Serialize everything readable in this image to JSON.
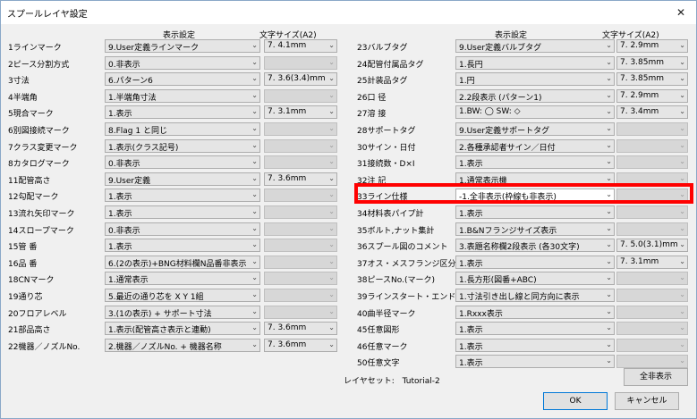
{
  "window": {
    "title": "スプールレイヤ設定",
    "close": "✕"
  },
  "headers": {
    "display": "表示設定",
    "font_size": "文字サイズ(A2)"
  },
  "left_rows": [
    {
      "label": "1ラインマーク",
      "display": "9.User定義ラインマーク",
      "size": "7. 4.1mm",
      "size_enabled": true
    },
    {
      "label": "2ピース分割方式",
      "display": "0.非表示",
      "size": "",
      "size_enabled": false
    },
    {
      "label": "3寸法",
      "display": "6.パターン6",
      "size": "7. 3.6(3.4)mm",
      "size_enabled": true
    },
    {
      "label": "4半端角",
      "display": "1.半端角寸法",
      "size": "",
      "size_enabled": false
    },
    {
      "label": "5現合マーク",
      "display": "1.表示",
      "size": "7. 3.1mm",
      "size_enabled": true
    },
    {
      "label": "6別図接続マーク",
      "display": "8.Flag 1 と同じ",
      "size": "",
      "size_enabled": false
    },
    {
      "label": "7クラス変更マーク",
      "display": "1.表示(クラス記号)",
      "size": "",
      "size_enabled": false
    },
    {
      "label": "8カタログマーク",
      "display": "0.非表示",
      "size": "",
      "size_enabled": false
    },
    {
      "label": "11配管高さ",
      "display": "9.User定義",
      "size": "7. 3.6mm",
      "size_enabled": true
    },
    {
      "label": "12勾配マーク",
      "display": "1.表示",
      "size": "",
      "size_enabled": false
    },
    {
      "label": "13流れ矢印マーク",
      "display": "1.表示",
      "size": "",
      "size_enabled": false
    },
    {
      "label": "14スロープマーク",
      "display": "0.非表示",
      "size": "",
      "size_enabled": false
    },
    {
      "label": "15管 番",
      "display": "1.表示",
      "size": "",
      "size_enabled": false
    },
    {
      "label": "16品 番",
      "display": "6.(2の表示)+BNG材料欄N品番非表示",
      "size": "",
      "size_enabled": false
    },
    {
      "label": "18CNマーク",
      "display": "1.通常表示",
      "size": "",
      "size_enabled": false
    },
    {
      "label": "19通り芯",
      "display": "5.最近の通り芯を X Y 1組",
      "size": "",
      "size_enabled": false
    },
    {
      "label": "20フロアレベル",
      "display": "3.(1の表示) + サポート寸法",
      "size": "",
      "size_enabled": false
    },
    {
      "label": "21部品高さ",
      "display": "1.表示(配管高さ表示と連動)",
      "size": "7. 3.6mm",
      "size_enabled": true
    },
    {
      "label": "22機器／ノズルNo.",
      "display": "2.機器／ノズルNo. + 機器名称",
      "size": "7. 3.6mm",
      "size_enabled": true
    }
  ],
  "right_rows": [
    {
      "label": "23バルブタグ",
      "display": "9.User定義バルブタグ",
      "size": "7. 2.9mm",
      "size_enabled": true
    },
    {
      "label": "24配管付属品タグ",
      "display": "1.長円",
      "size": "7. 3.85mm",
      "size_enabled": true
    },
    {
      "label": "25計装品タグ",
      "display": "1.円",
      "size": "7. 3.85mm",
      "size_enabled": true
    },
    {
      "label": "26口 径",
      "display": "2.2段表示 (パターン1)",
      "size": "7. 2.9mm",
      "size_enabled": true
    },
    {
      "label": "27溶 接",
      "display": "1.BW: ◯  SW: ◇",
      "size": "7. 3.4mm",
      "size_enabled": true
    },
    {
      "label": "28サポートタグ",
      "display": "9.User定義サポートタグ",
      "size": "",
      "size_enabled": false
    },
    {
      "label": "30サイン・日付",
      "display": "2.各種承認者サイン／日付",
      "size": "",
      "size_enabled": false
    },
    {
      "label": "31接続数・D×I",
      "display": "1.表示",
      "size": "",
      "size_enabled": false
    },
    {
      "label": "32注 記",
      "display": "1.通常表示機",
      "size": "",
      "size_enabled": false
    },
    {
      "label": "33ライン仕様",
      "display": "-1.全非表示(枠線も非表示)",
      "size": "",
      "size_enabled": false,
      "selected": true
    },
    {
      "label": "34材料表パイプ計",
      "display": "1.表示",
      "size": "",
      "size_enabled": false
    },
    {
      "label": "35ボルト,ナット集計",
      "display": "1.B&Nフランジサイズ表示",
      "size": "",
      "size_enabled": false
    },
    {
      "label": "36スプール図のコメント",
      "display": "3.表題名称欄2段表示 (各30文字)",
      "size": "7. 5.0(3.1)mm",
      "size_enabled": true
    },
    {
      "label": "37オス・メスフランジ区分",
      "display": "1.表示",
      "size": "7. 3.1mm",
      "size_enabled": true
    },
    {
      "label": "38ピースNo.(マーク)",
      "display": "1.長方形(図番+ABC)",
      "size": "",
      "size_enabled": false
    },
    {
      "label": "39ラインスタート・エンド",
      "display": "1.寸法引き出し線と同方向に表示",
      "size": "",
      "size_enabled": false
    },
    {
      "label": "40曲半径マーク",
      "display": "1.Rxxx表示",
      "size": "",
      "size_enabled": false
    },
    {
      "label": "45任意図形",
      "display": "1.表示",
      "size": "",
      "size_enabled": false
    },
    {
      "label": "46任意マーク",
      "display": "1.表示",
      "size": "",
      "size_enabled": false
    },
    {
      "label": "50任意文字",
      "display": "1.表示",
      "size": "",
      "size_enabled": false
    }
  ],
  "footer": {
    "layer_set_label": "レイヤセット:",
    "layer_set_value": "Tutorial-2",
    "all_hide": "全非表示",
    "ok": "OK",
    "cancel": "キャンセル"
  },
  "colors": {
    "highlight": "#ff0000",
    "combo_bg": "#e5e5e5",
    "disabled_bg": "#d7d7d7"
  },
  "icons": {
    "dropdown": "chevron-down-icon",
    "close": "close-icon"
  }
}
